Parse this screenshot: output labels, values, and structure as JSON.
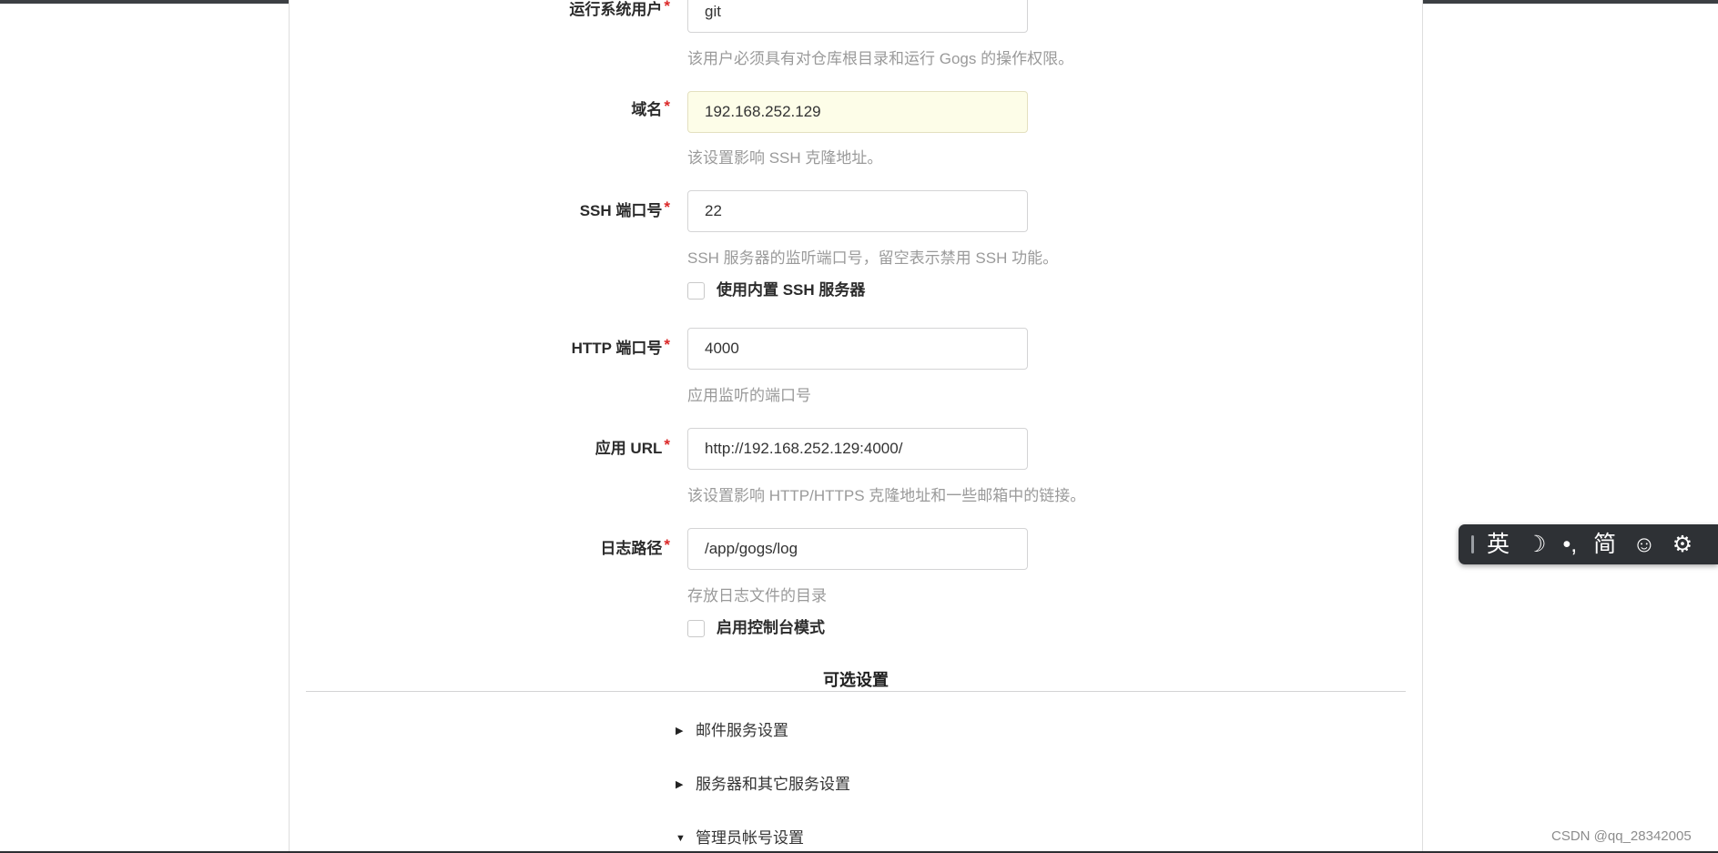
{
  "form": {
    "run_user": {
      "label": "运行系统用户",
      "required": "*",
      "value": "git",
      "help": "该用户必须具有对仓库根目录和运行 Gogs 的操作权限。"
    },
    "domain": {
      "label": "域名",
      "required": "*",
      "value": "192.168.252.129",
      "help": "该设置影响 SSH 克隆地址。"
    },
    "ssh_port": {
      "label": "SSH 端口号",
      "required": "*",
      "value": "22",
      "help": "SSH 服务器的监听端口号，留空表示禁用 SSH 功能。",
      "checkbox_label": "使用内置 SSH 服务器"
    },
    "http_port": {
      "label": "HTTP 端口号",
      "required": "*",
      "value": "4000",
      "help": "应用监听的端口号"
    },
    "app_url": {
      "label": "应用 URL",
      "required": "*",
      "value": "http://192.168.252.129:4000/",
      "help": "该设置影响 HTTP/HTTPS 克隆地址和一些邮箱中的链接。"
    },
    "log_path": {
      "label": "日志路径",
      "required": "*",
      "value": "/app/gogs/log",
      "help": "存放日志文件的目录",
      "checkbox_label": "启用控制台模式"
    }
  },
  "optional": {
    "title": "可选设置",
    "sections": [
      {
        "label": "邮件服务设置",
        "state": "collapsed"
      },
      {
        "label": "服务器和其它服务设置",
        "state": "collapsed"
      },
      {
        "label": "管理员帐号设置",
        "state": "expanded"
      }
    ]
  },
  "ime_toolbar": {
    "lang": "英",
    "moon": "☽",
    "punct": "•,",
    "script": "简",
    "emoji": "☺",
    "gear": "⚙"
  },
  "watermark": "CSDN @qq_28342005"
}
